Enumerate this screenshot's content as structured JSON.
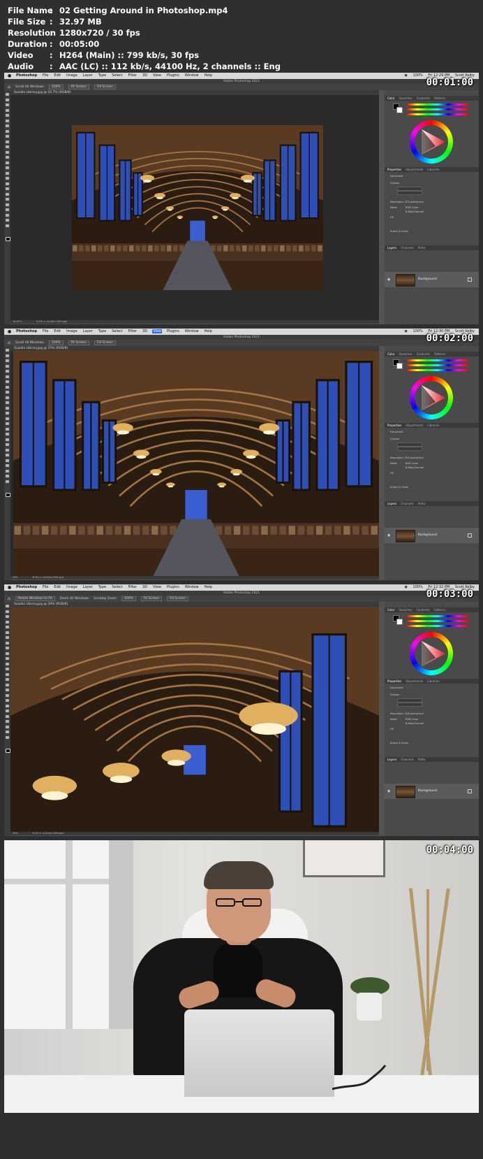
{
  "info": {
    "rows": [
      {
        "key": "File Name",
        "value": "02 Getting Around in Photoshop.mp4"
      },
      {
        "key": "File Size",
        "value": "32.97 MB"
      },
      {
        "key": "Resolution",
        "value": "1280x720 / 30 fps"
      },
      {
        "key": "Duration",
        "value": "00:05:00"
      },
      {
        "key": "Video",
        "value": "H264 (Main) :: 799 kb/s, 30 fps"
      },
      {
        "key": "Audio",
        "value": "AAC (LC) :: 112 kb/s, 44100 Hz, 2 channels :: Eng"
      }
    ],
    "separator": ":"
  },
  "menu": {
    "items": [
      "Photoshop",
      "File",
      "Edit",
      "Image",
      "Layer",
      "Type",
      "Select",
      "Filter",
      "3D",
      "View",
      "Plugins",
      "Window",
      "Help"
    ],
    "battery": "100%",
    "user": "Scott Kelby"
  },
  "app_title": "Adobe Photoshop 2021",
  "panels": {
    "color_tabs": [
      "Color",
      "Swatches",
      "Gradients",
      "Patterns"
    ],
    "prop_tabs": [
      "Properties",
      "Adjustments",
      "Libraries"
    ],
    "document_label": "Document",
    "canvas_label": "Canvas",
    "resolution_label": "Resolution: 300 pixels/inch",
    "mode_label": "Mode",
    "mode_value": "RGB Color",
    "bits_value": "8 Bits/Channel",
    "fill_label": "Fill",
    "rulers_label": "Rulers & Grids",
    "layer_tabs": [
      "Layers",
      "Channels",
      "Paths"
    ],
    "layer_name": "Background"
  },
  "frames": [
    {
      "timestamp": "00:01:00",
      "clock": "Fri 12:29 PM",
      "active_menu": "",
      "tab": "Suzallo Library.jpg @ 16.7% (RGB/8)",
      "options": [
        "Scroll All Windows",
        "100%",
        "Fit Screen",
        "Fill Screen"
      ],
      "zoom_status": "16.67%",
      "doc_status": "8.7in × 14.04in (300 ppi)"
    },
    {
      "timestamp": "00:02:00",
      "clock": "Fri 12:30 PM",
      "active_menu": "View",
      "tab": "Suzallo Library.jpg @ 25% (RGB/8)",
      "options": [
        "Scroll All Windows",
        "100%",
        "Fit Screen",
        "Fill Screen"
      ],
      "zoom_status": "25%",
      "doc_status": "8.7in × 14.04in (300 ppi)"
    },
    {
      "timestamp": "00:03:00",
      "clock": "Fri 12:32 PM",
      "active_menu": "",
      "tab": "Suzallo Library.jpg @ 50% (RGB/8)",
      "options": [
        "Resize Windows to Fit",
        "Zoom All Windows",
        "Scrubby Zoom",
        "100%",
        "Fit Screen",
        "Fill Screen"
      ],
      "zoom_status": "50%",
      "doc_status": "8.7in × 14.04in (300 ppi)"
    },
    {
      "timestamp": "00:04:00"
    }
  ],
  "colors": {
    "menubar": "#d8d8d8",
    "workspace": "#535353",
    "panel": "#4a4a4a",
    "menu_active": "#2f6be3"
  }
}
